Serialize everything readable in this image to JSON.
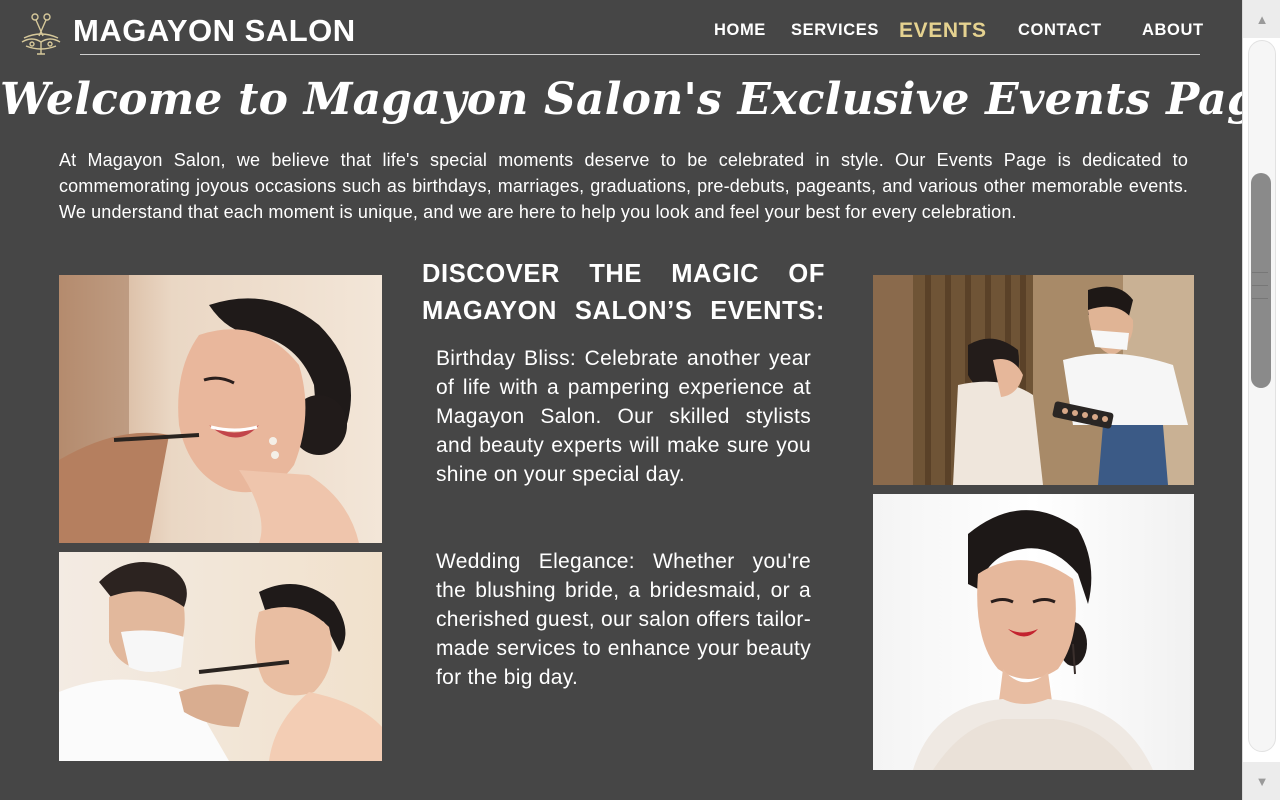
{
  "header": {
    "brand": "MAGAYON SALON",
    "logo_icon": "scissors-crest-icon",
    "nav": [
      {
        "label": "HOME",
        "active": false
      },
      {
        "label": "SERVICES",
        "active": false
      },
      {
        "label": "EVENTS",
        "active": true
      },
      {
        "label": "CONTACT",
        "active": false
      },
      {
        "label": "ABOUT",
        "active": false
      }
    ]
  },
  "hero": {
    "title": "Welcome to Magayon Salon's Exclusive Events Page!",
    "intro": "At Magayon Salon, we believe that life's special moments deserve to be celebrated in style. Our Events Page is dedicated to commemorating joyous occasions such as birthdays, marriages, graduations, pre-debuts, pageants, and various other memorable events. We understand that each moment is unique, and we are here to help you look and feel your best for every celebration."
  },
  "section": {
    "heading_line1": "DISCOVER THE MAGIC OF",
    "heading_line2": "MAGAYON SALON’S EVENTS:",
    "events": [
      {
        "text": "Birthday Bliss: Celebrate another year of life with a pampering experience at Magayon Salon. Our skilled stylists and beauty experts will make sure you shine on your special day."
      },
      {
        "text": "Wedding Elegance: Whether you're the blushing bride, a bridesmaid, or a cherished guest, our salon offers tailor-made services to enhance your beauty for the big day."
      }
    ]
  },
  "colors": {
    "background": "#464646",
    "text": "#ffffff",
    "accent_active_nav": "#e5d290"
  },
  "scrollbar": {
    "up_icon": "arrow-up-icon",
    "down_icon": "arrow-down-icon"
  }
}
